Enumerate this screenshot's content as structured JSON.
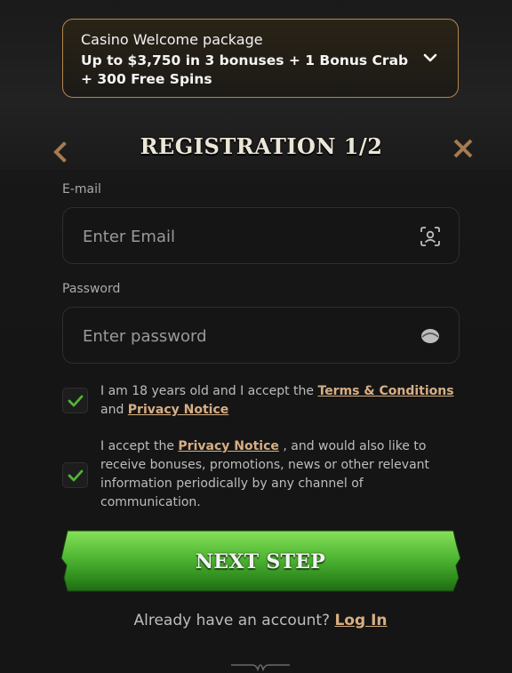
{
  "welcome": {
    "title": "Casino Welcome package",
    "offer": "Up to $3,750 in 3 bonuses + 1 Bonus Crab + 300 Free Spins",
    "toggle_icon": "chevron-down-icon"
  },
  "header": {
    "title": "REGISTRATION 1/2",
    "back_icon": "chevron-left-icon",
    "close_icon": "close-icon"
  },
  "email": {
    "label": "E-mail",
    "placeholder": "Enter Email",
    "value": "",
    "icon": "face-id-icon"
  },
  "password": {
    "label": "Password",
    "placeholder": "Enter password",
    "value": "",
    "icon": "eye-icon"
  },
  "consents": [
    {
      "checked": true,
      "text_before": "I am 18 years old and I accept the ",
      "link1": "Terms & Conditions",
      "text_middle": " and ",
      "link2": "Privacy Notice"
    },
    {
      "checked": true,
      "text_before": "I accept the ",
      "link1": "Privacy Notice",
      "text_after": " , and would also like to receive bonuses, promotions, news or other relevant information periodically by any channel of communication."
    }
  ],
  "next_button": {
    "label": "NEXT STEP"
  },
  "login": {
    "prompt": "Already have an account? ",
    "link": "Log In"
  },
  "colors": {
    "accent_gold": "#d7ae84",
    "border_gold": "#b5874e",
    "button_green": "#4fb633",
    "check_green": "#4fb633",
    "background": "#151515"
  }
}
